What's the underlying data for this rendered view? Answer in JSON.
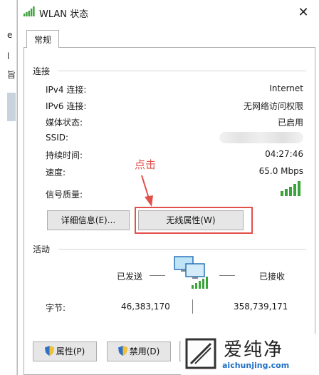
{
  "background_window": {
    "fragments": [
      "e",
      "l",
      "旨"
    ]
  },
  "window": {
    "title": "WLAN 状态",
    "close_symbol": "✕"
  },
  "tabs": [
    {
      "label": "常规"
    }
  ],
  "connection": {
    "heading": "连接",
    "rows": [
      {
        "label": "IPv4 连接:",
        "value": "Internet"
      },
      {
        "label": "IPv6 连接:",
        "value": "无网络访问权限"
      },
      {
        "label": "媒体状态:",
        "value": "已启用"
      },
      {
        "label": "SSID:",
        "value": ""
      },
      {
        "label": "持续时间:",
        "value": "04:27:46"
      },
      {
        "label": "速度:",
        "value": "65.0 Mbps"
      },
      {
        "label": "信号质量:",
        "signal_bars": 5,
        "signal_level": 1.0
      }
    ],
    "details_button": "详细信息(E)...",
    "wireless_props_button": "无线属性(W)"
  },
  "annotation": {
    "text": "点击",
    "color": "#e2504b"
  },
  "activity": {
    "heading": "活动",
    "sent_label": "已发送",
    "received_label": "已接收",
    "bytes_label": "字节:",
    "bytes_sent": "46,383,170",
    "bytes_received": "358,739,171"
  },
  "bottom_buttons": {
    "properties": "属性(P)",
    "disable": "禁用(D)"
  },
  "watermark": {
    "brand_cn": "爱纯净",
    "url": "aichunjing.com"
  },
  "colors": {
    "signal_green": "#3aa33a",
    "accent_red": "#e2504b",
    "url_blue": "#1f6fc5"
  }
}
